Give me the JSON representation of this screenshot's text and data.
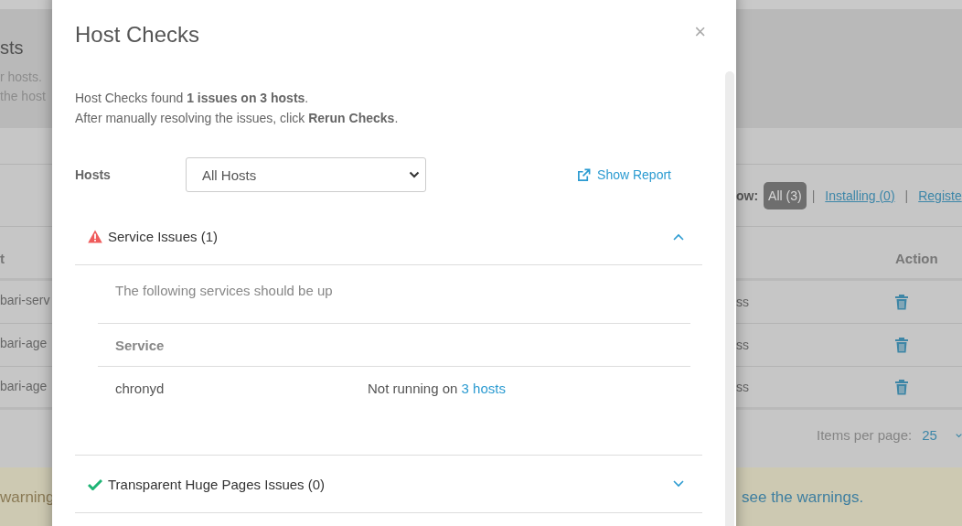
{
  "page": {
    "title": "sts",
    "description_lines": [
      "r hosts.",
      "the host"
    ],
    "filter_label": "ow:",
    "filters": [
      {
        "label": "All (3)",
        "selected": true
      },
      {
        "label": "Installing (0)",
        "selected": false
      },
      {
        "label": "Registe",
        "selected": false
      }
    ],
    "separators": [
      "|",
      "|"
    ],
    "column_left": "t",
    "column_action": "Action",
    "rows": [
      {
        "name": "bari-serv",
        "status": "ss"
      },
      {
        "name": "bari-age",
        "status": "ss"
      },
      {
        "name": "bari-age",
        "status": "ss"
      }
    ],
    "items_per_page_label": "Items per page:",
    "items_per_page": "25",
    "warning_text": "warning",
    "warning_link": "see the warnings."
  },
  "modal": {
    "title": "Host Checks",
    "close": "×",
    "message_lines": [
      "Host Checks found **1 issues on 3 hosts**.",
      "After manually resolving the issues, click **Rerun Checks**."
    ],
    "hosts_label": "Hosts",
    "hosts_select": "All Hosts",
    "show_report": "Show Report",
    "sections": [
      {
        "kind": "warning",
        "title": "Service Issues (1)",
        "expanded": true,
        "description": "The following services should be up",
        "columns": [
          "Service"
        ],
        "rows": [
          {
            "service": "chronyd",
            "status": "Not running on",
            "link": "3 hosts"
          }
        ]
      },
      {
        "kind": "ok",
        "title": "Transparent Huge Pages Issues (0)",
        "expanded": false
      }
    ]
  }
}
